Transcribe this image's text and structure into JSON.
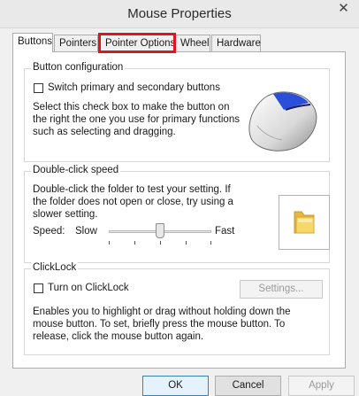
{
  "window": {
    "title": "Mouse Properties",
    "close_glyph": "✕"
  },
  "tabs": [
    {
      "label": "Buttons"
    },
    {
      "label": "Pointers"
    },
    {
      "label": "Pointer Options"
    },
    {
      "label": "Wheel"
    },
    {
      "label": "Hardware"
    }
  ],
  "button_config": {
    "legend": "Button configuration",
    "checkbox_label": "Switch primary and secondary buttons",
    "checked": false,
    "description": "Select this check box to make the button on the right the one you use for primary functions such as selecting and dragging."
  },
  "double_click": {
    "legend": "Double-click speed",
    "description": "Double-click the folder to test your setting. If the folder does not open or close, try using a slower setting.",
    "speed_label": "Speed:",
    "slow_label": "Slow",
    "fast_label": "Fast",
    "speed_fraction": 0.5
  },
  "clicklock": {
    "legend": "ClickLock",
    "checkbox_label": "Turn on ClickLock",
    "checked": false,
    "settings_button": "Settings...",
    "description": "Enables you to highlight or drag without holding down the mouse button. To set, briefly press the mouse button. To release, click the mouse button again."
  },
  "footer": {
    "ok": "OK",
    "cancel": "Cancel",
    "apply": "Apply"
  },
  "colors": {
    "highlight": "#e0141e",
    "mouse_accent": "#2b4fd8",
    "folder": "#f2cf5a"
  },
  "icons": [
    "mouse-icon",
    "folder-icon",
    "close-icon"
  ]
}
